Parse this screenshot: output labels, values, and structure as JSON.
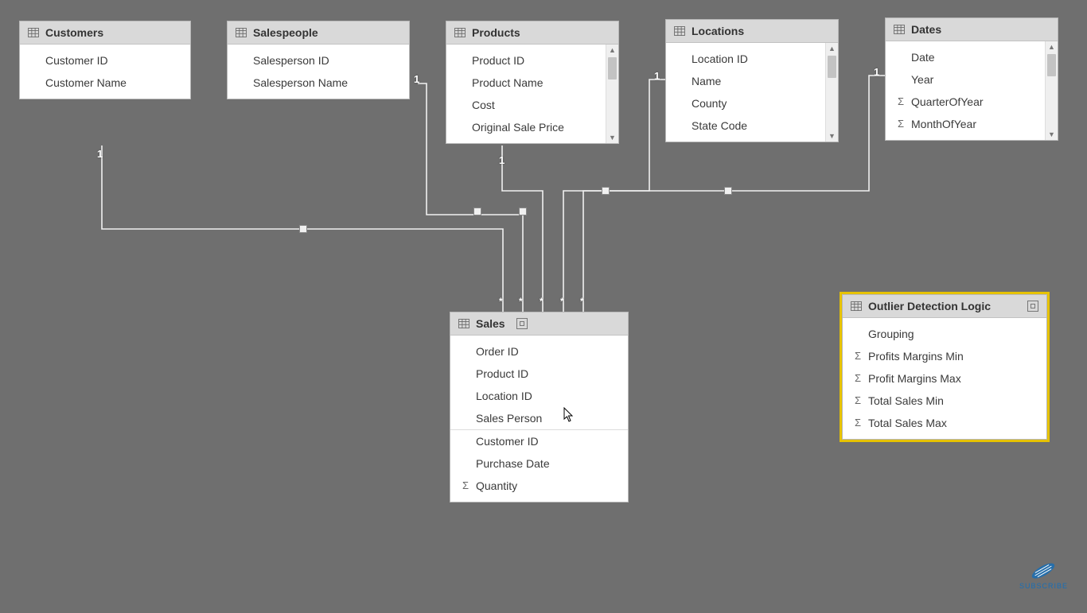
{
  "relationship_labels": {
    "one": "1",
    "many": "*"
  },
  "tables": {
    "customers": {
      "title": "Customers",
      "fields": [
        {
          "name": "Customer ID",
          "measure": false
        },
        {
          "name": "Customer Name",
          "measure": false
        }
      ]
    },
    "salespeople": {
      "title": "Salespeople",
      "fields": [
        {
          "name": "Salesperson ID",
          "measure": false
        },
        {
          "name": "Salesperson Name",
          "measure": false
        }
      ]
    },
    "products": {
      "title": "Products",
      "scroll": true,
      "fields": [
        {
          "name": "Product ID",
          "measure": false
        },
        {
          "name": "Product Name",
          "measure": false
        },
        {
          "name": "Cost",
          "measure": false
        },
        {
          "name": "Original Sale Price",
          "measure": false
        }
      ]
    },
    "locations": {
      "title": "Locations",
      "scroll": true,
      "fields": [
        {
          "name": "Location ID",
          "measure": false
        },
        {
          "name": "Name",
          "measure": false
        },
        {
          "name": "County",
          "measure": false
        },
        {
          "name": "State Code",
          "measure": false
        }
      ]
    },
    "dates": {
      "title": "Dates",
      "scroll": true,
      "fields": [
        {
          "name": "Date",
          "measure": false
        },
        {
          "name": "Year",
          "measure": false
        },
        {
          "name": "QuarterOfYear",
          "measure": true
        },
        {
          "name": "MonthOfYear",
          "measure": true
        }
      ]
    },
    "sales": {
      "title": "Sales",
      "fields": [
        {
          "name": "Order ID",
          "measure": false
        },
        {
          "name": "Product ID",
          "measure": false
        },
        {
          "name": "Location ID",
          "measure": false
        },
        {
          "name": "Sales Person",
          "measure": false
        },
        {
          "name": "Customer ID",
          "measure": false,
          "sep_above": true
        },
        {
          "name": "Purchase Date",
          "measure": false
        },
        {
          "name": "Quantity",
          "measure": true
        }
      ]
    },
    "outlier": {
      "title": "Outlier Detection Logic",
      "fields": [
        {
          "name": "Grouping",
          "measure": false
        },
        {
          "name": "Profits Margins Min",
          "measure": true
        },
        {
          "name": "Profit Margins Max",
          "measure": true
        },
        {
          "name": "Total Sales Min",
          "measure": true
        },
        {
          "name": "Total Sales Max",
          "measure": true
        }
      ]
    }
  },
  "watermark": {
    "text": "SUBSCRIBE"
  }
}
